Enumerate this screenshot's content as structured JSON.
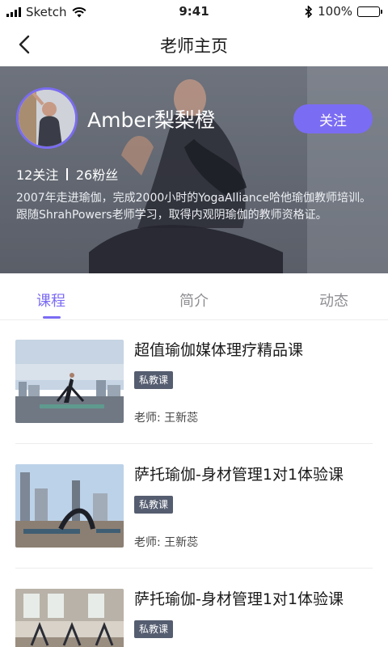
{
  "status_bar": {
    "carrier": "Sketch",
    "time": "9:41",
    "battery": "100%"
  },
  "nav": {
    "title": "老师主页",
    "back_icon": "chevron-left-icon"
  },
  "profile": {
    "name": "Amber梨梨橙",
    "follow_label": "关注",
    "following": "12关注",
    "followers": "26粉丝",
    "bio": "2007年走进瑜伽，完成2000小时的YogaAlliance哈他瑜伽教师培训。跟随ShrahPowers老师学习，取得内观阴瑜伽的教师资格证。",
    "accent_color": "#7b6cf4"
  },
  "tabs": [
    {
      "label": "课程",
      "active": true
    },
    {
      "label": "简介",
      "active": false
    },
    {
      "label": "动态",
      "active": false
    }
  ],
  "courses": [
    {
      "title": "超值瑜伽媒体理疗精品课",
      "tag": "私教课",
      "teacher": "老师: 王新蕊"
    },
    {
      "title": "萨托瑜伽-身材管理1对1体验课",
      "tag": "私教课",
      "teacher": "老师: 王新蕊"
    },
    {
      "title": "萨托瑜伽-身材管理1对1体验课",
      "tag": "私教课",
      "teacher": ""
    }
  ]
}
